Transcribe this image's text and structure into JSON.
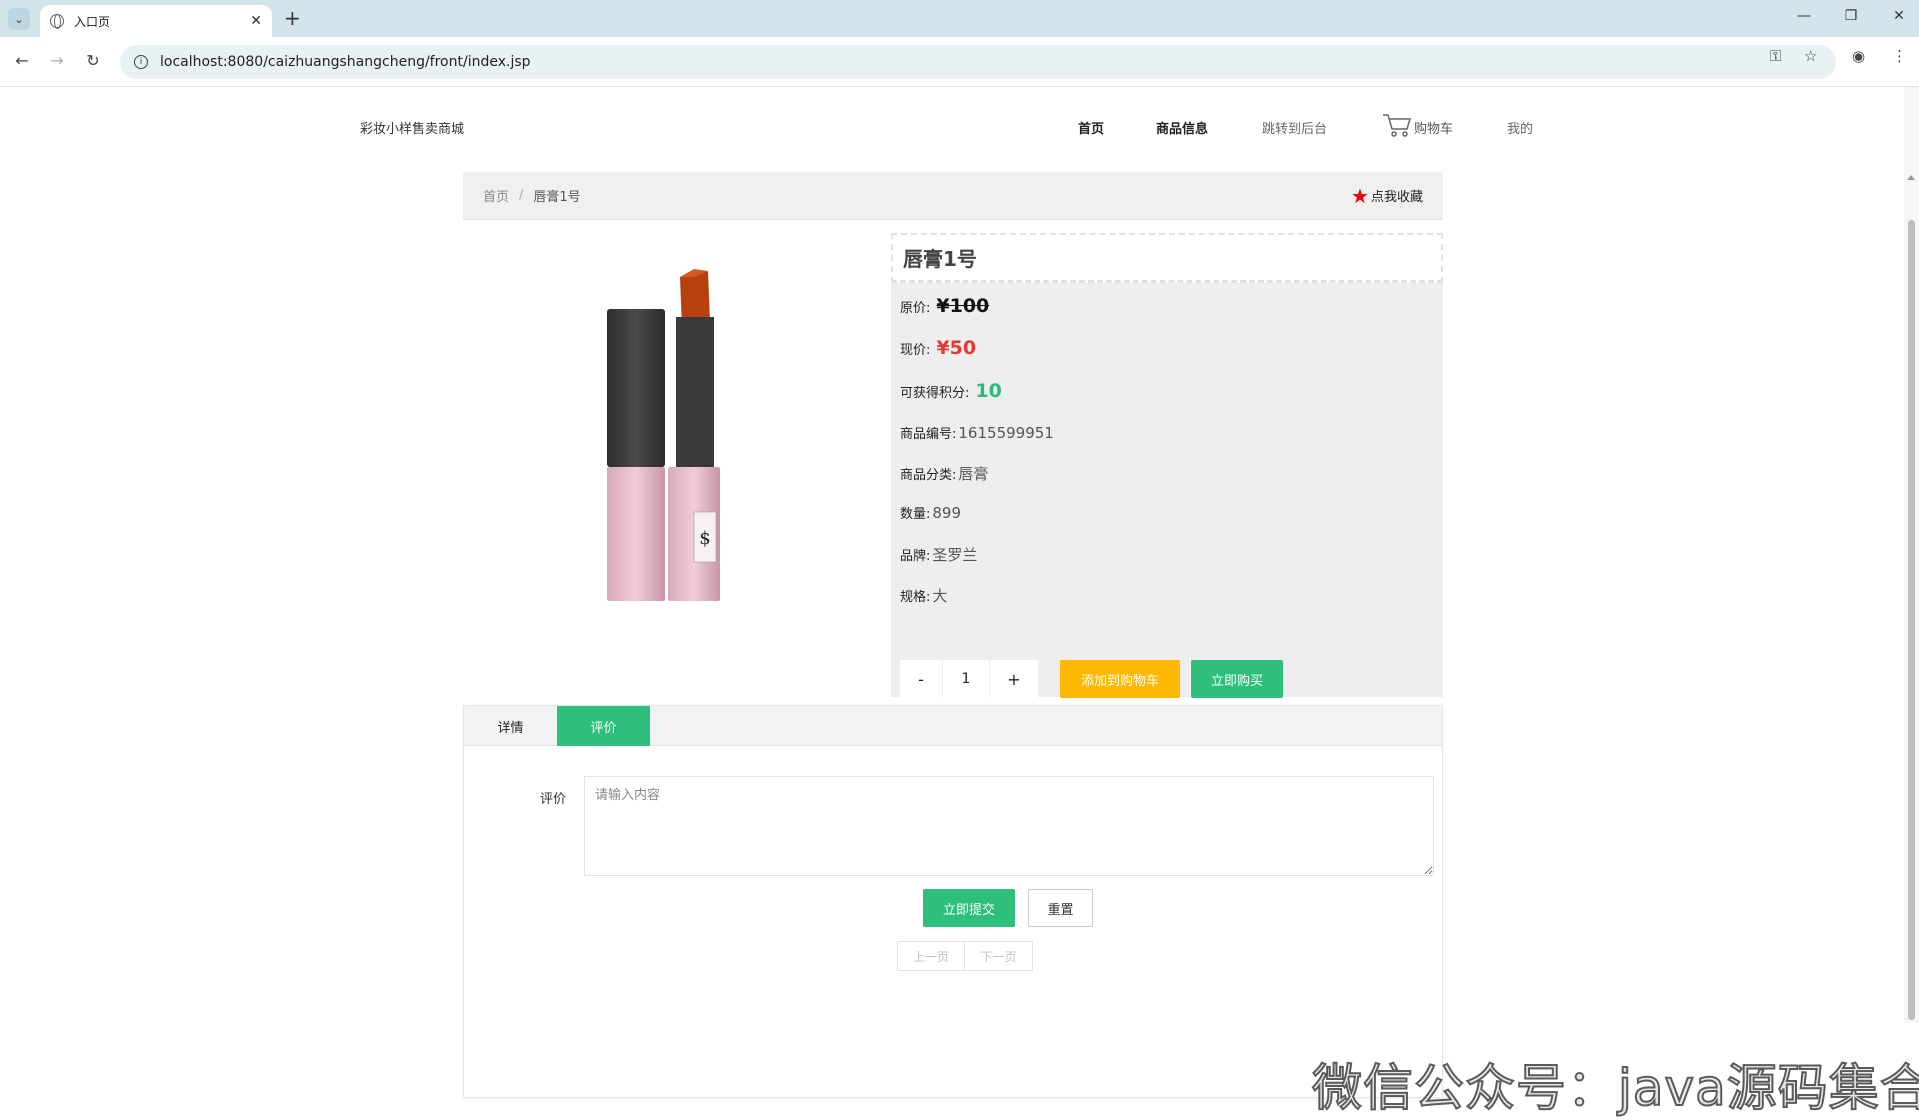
{
  "browser": {
    "tab_title": "入口页",
    "url": "localhost:8080/caizhuangshangcheng/front/index.jsp"
  },
  "header": {
    "logo": "彩妆小样售卖商城",
    "nav": [
      "首页",
      "商品信息",
      "跳转到后台",
      "购物车",
      "我的"
    ]
  },
  "breadcrumb": {
    "home": "首页",
    "separator": "/",
    "current": "唇膏1号",
    "favorite": "点我收藏"
  },
  "product": {
    "name": "唇膏1号",
    "original_price_label": "原价:",
    "original_price": "¥100",
    "current_price_label": "现价:",
    "current_price": "¥50",
    "points_label": "可获得积分:",
    "points": "10",
    "code_label": "商品编号:",
    "code": "1615599951",
    "category_label": "商品分类:",
    "category": "唇膏",
    "quantity_label": "数量:",
    "quantity": "899",
    "brand_label": "品牌:",
    "brand": "圣罗兰",
    "spec_label": "规格:",
    "spec": "大"
  },
  "purchase": {
    "minus": "-",
    "qty": "1",
    "plus": "+",
    "add_to_cart": "添加到购物车",
    "buy_now": "立即购买"
  },
  "tabs": {
    "details": "详情",
    "reviews": "评价"
  },
  "review_form": {
    "label": "评价",
    "placeholder": "请输入内容",
    "submit": "立即提交",
    "reset": "重置",
    "prev": "上一页",
    "next": "下一页"
  },
  "watermark": "微信公众号：java源码集合",
  "colors": {
    "accent_green": "#2dbf7b",
    "accent_orange": "#ffb800",
    "price_red": "#e53935",
    "star_red": "#ee0000"
  }
}
